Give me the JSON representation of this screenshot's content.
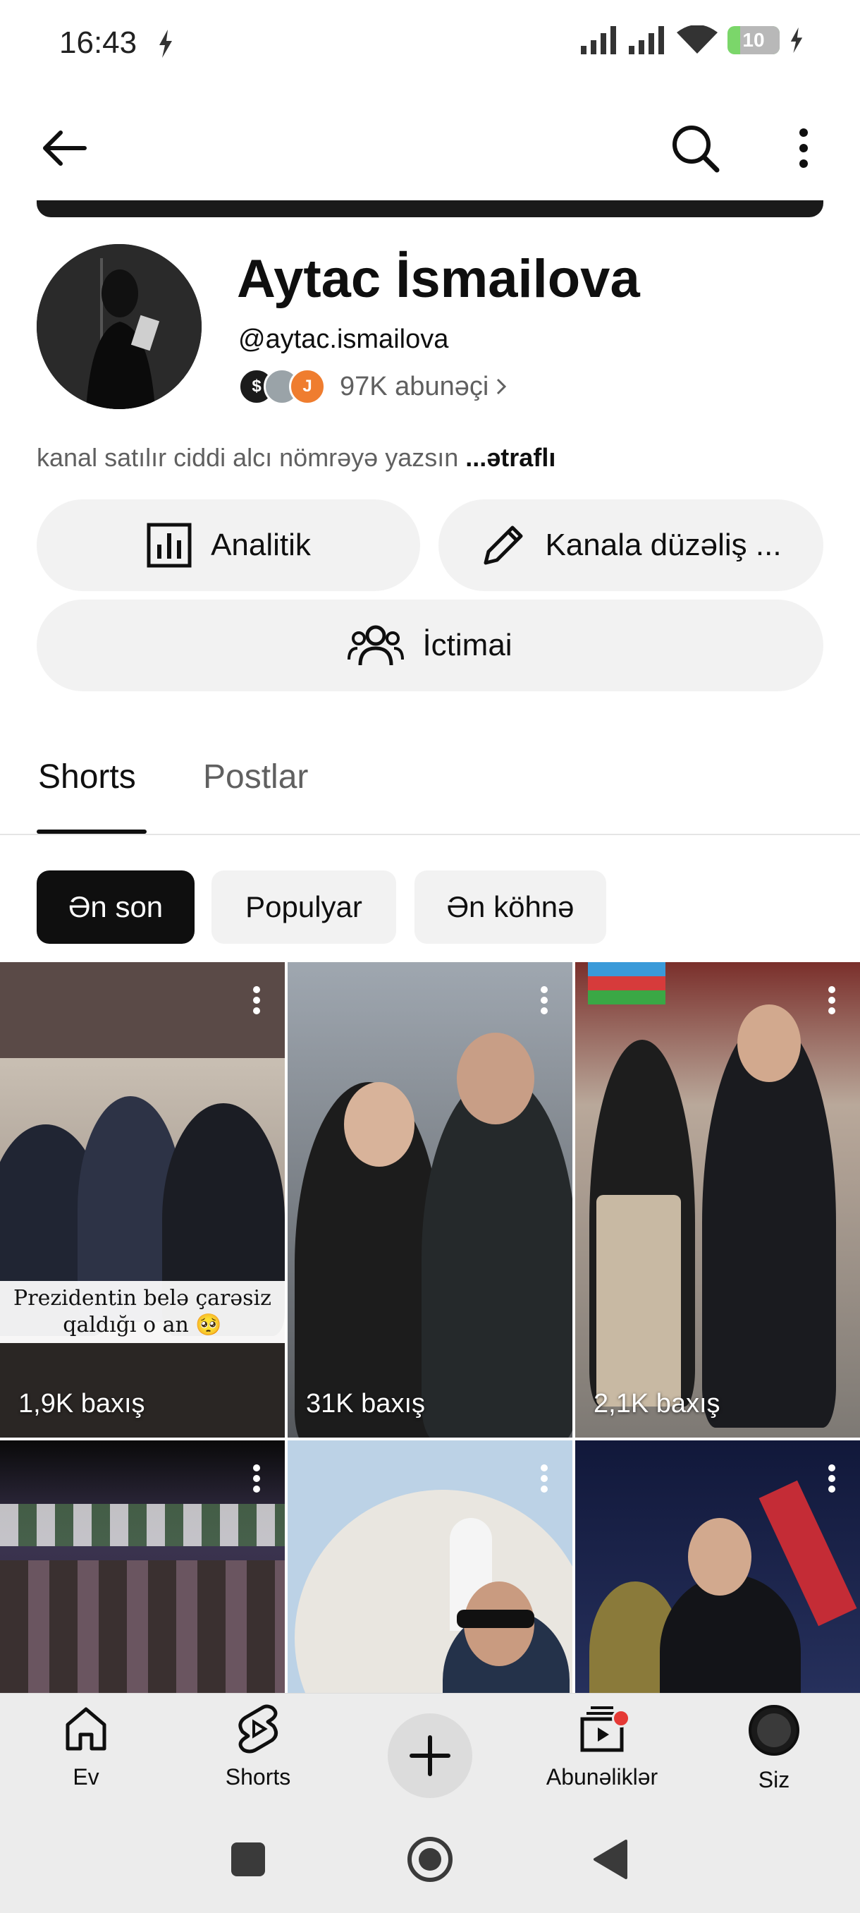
{
  "status_bar": {
    "time": "16:43",
    "battery": "10"
  },
  "channel": {
    "name": "Aytac İsmailova",
    "handle": "@aytac.ismailova",
    "subscribers": "97K abunəçi",
    "sub_avatars": [
      "$",
      "",
      "J"
    ],
    "description": "kanal satılır ciddi alcı nömrəyə yazsın",
    "more_label": "...ətraflı"
  },
  "actions": {
    "analytics": "Analitik",
    "edit": "Kanala düzəliş ...",
    "public": "İctimai"
  },
  "tabs": [
    {
      "label": "Shorts",
      "active": true
    },
    {
      "label": "Postlar",
      "active": false
    }
  ],
  "chips": [
    {
      "label": "Ən son",
      "selected": true
    },
    {
      "label": "Populyar",
      "selected": false
    },
    {
      "label": "Ən köhnə",
      "selected": false
    }
  ],
  "shorts": [
    {
      "views": "1,9K baxış",
      "caption": "Prezidentin belə çarəsiz qaldığı o an 🥺"
    },
    {
      "views": "31K baxış",
      "caption": ""
    },
    {
      "views": "2,1K baxış",
      "caption": ""
    },
    {
      "views": "",
      "caption": ""
    },
    {
      "views": "",
      "caption": ""
    },
    {
      "views": "",
      "caption": ""
    }
  ],
  "bottom_nav": {
    "home": "Ev",
    "shorts": "Shorts",
    "subscriptions": "Abunəliklər",
    "you": "Siz"
  },
  "colors": {
    "accent": "#0f0f0f",
    "badge": "#e53935",
    "chip_bg": "#f2f2f2"
  }
}
